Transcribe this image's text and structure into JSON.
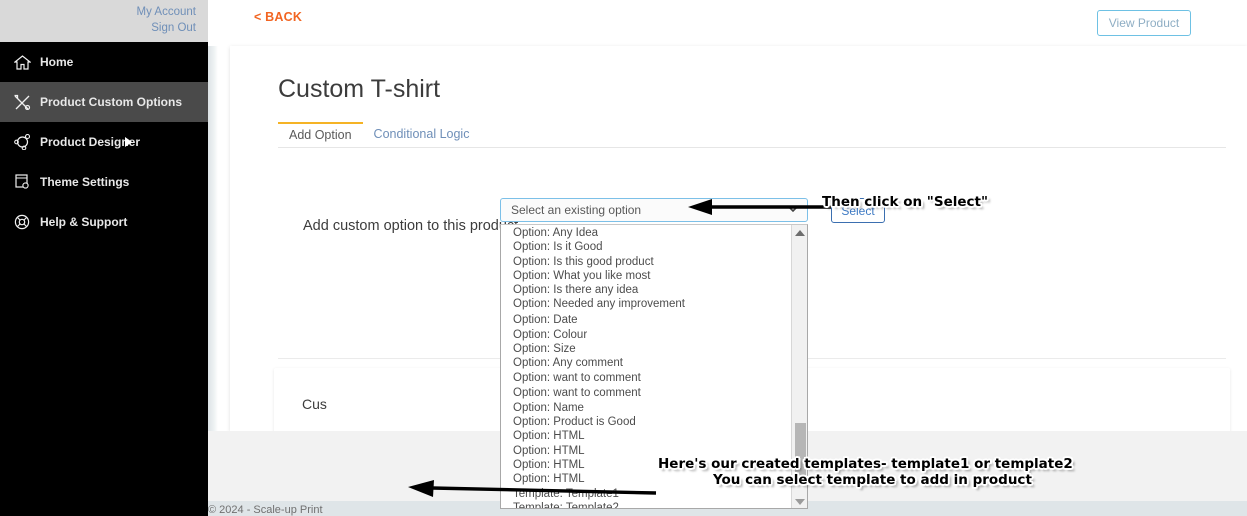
{
  "account": {
    "my_account": "My Account",
    "sign_out": "Sign Out"
  },
  "sidebar": {
    "items": [
      {
        "label": "Home",
        "icon": "home-icon",
        "active": false,
        "has_caret": false
      },
      {
        "label": "Product Custom Options",
        "icon": "tools-icon",
        "active": true,
        "has_caret": false
      },
      {
        "label": "Product Designer",
        "icon": "design-node-icon",
        "active": false,
        "has_caret": true
      },
      {
        "label": "Theme Settings",
        "icon": "monitor-gear-icon",
        "active": false,
        "has_caret": false
      },
      {
        "label": "Help & Support",
        "icon": "lifebuoy-icon",
        "active": false,
        "has_caret": false
      }
    ]
  },
  "topbar": {
    "back_label": "< BACK",
    "view_product_label": "View Product"
  },
  "page": {
    "title": "Custom T-shirt",
    "tabs": [
      {
        "label": "Add Option",
        "active": true
      },
      {
        "label": "Conditional Logic",
        "active": false
      }
    ],
    "section_label": "Add custom option to this product",
    "sub_card_title": "Cus"
  },
  "select": {
    "value": "Select an existing option",
    "button_label": "Select",
    "options": [
      "Option: Any Idea",
      "Option: Is it Good",
      "Option: Is this good product",
      "Option: What you like most",
      "Option: Is there any idea",
      "Option: Needed any improvement",
      "Option: Date",
      "Option: Colour",
      "Option: Size",
      "Option: Any comment",
      "Option: want to comment",
      "Option: want to comment",
      "Option: Name",
      "Option: Product is Good",
      "Option: HTML",
      "Option: HTML",
      "Option: HTML",
      "Option: HTML",
      "Template: Template1",
      "Template: Template2"
    ]
  },
  "annotations": {
    "top": "Then click on \"Select\"",
    "bottom_line1": "Here's our created templates- template1 or template2",
    "bottom_line2": "You can select template to add in product"
  },
  "footer": {
    "copyright": "© 2024 - Scale-up Print"
  },
  "colors": {
    "sidebar_bg": "#000000",
    "sidebar_active": "#4a4a4a",
    "header_gray": "#d9d9d9",
    "back_orange": "#f26522",
    "tab_active_underline": "#f5b325",
    "link_blue": "#6f8fb8",
    "select_border_blue": "#7cc0e8"
  }
}
